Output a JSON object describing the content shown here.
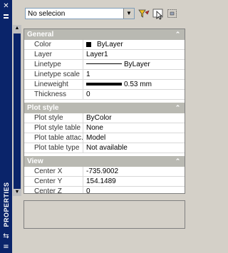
{
  "window": {
    "title": "PROPERTIES",
    "close_glyph": "✕",
    "autohide_glyph": "⇆",
    "menu_glyph": "≡"
  },
  "toolbar": {
    "selection_value": "No selecion",
    "quick_select_icon": "quick-select-icon",
    "select_objects_icon": "select-objects-icon",
    "pickadd_icon": "pickadd-icon"
  },
  "sections": [
    {
      "title": "General",
      "toggle": "⌃",
      "rows": [
        {
          "label": "Color",
          "value": "ByLayer"
        },
        {
          "label": "Layer",
          "value": "Layer1"
        },
        {
          "label": "Linetype",
          "value": "ByLayer"
        },
        {
          "label": "Linetype scale",
          "value": "1"
        },
        {
          "label": "Lineweight",
          "value": "0.53 mm"
        },
        {
          "label": "Thickness",
          "value": "0"
        }
      ]
    },
    {
      "title": "Plot style",
      "toggle": "⌃",
      "rows": [
        {
          "label": "Plot style",
          "value": "ByColor"
        },
        {
          "label": "Plot style table",
          "value": "None"
        },
        {
          "label": "Plot table attac...",
          "value": "Model"
        },
        {
          "label": "Plot table type",
          "value": "Not available"
        }
      ]
    },
    {
      "title": "View",
      "toggle": "⌃",
      "rows": [
        {
          "label": "Center X",
          "value": "-735.9002"
        },
        {
          "label": "Center Y",
          "value": "154.1489"
        },
        {
          "label": "Center Z",
          "value": "0"
        }
      ]
    }
  ],
  "colors": {
    "titlebar": "#0a246a",
    "section_header": "#b9b9b2",
    "panel": "#d4d0c8"
  }
}
